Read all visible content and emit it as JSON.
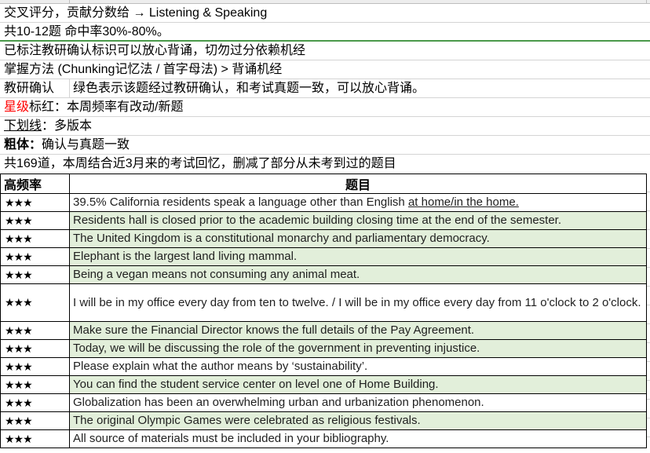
{
  "notes": [
    {
      "text": "交叉评分，贡献分数给 → Listening & Speaking"
    },
    {
      "text": "共10-12题  命中率30%-80%。"
    },
    {
      "text": "已标注教研确认标识可以放心背诵，切勿过分依赖机经"
    },
    {
      "text": "掌握方法 (Chunking记忆法 / 首字母法)  >  背诵机经"
    },
    {
      "label": "教研确认",
      "text": "绿色表示该题经过教研确认，和考试真题一致，可以放心背诵。"
    },
    {
      "red_part": "星级",
      "text": "标红：本周频率有改动/新题"
    },
    {
      "underlined_part": "下划线",
      "text": "：多版本"
    },
    {
      "bold_part": "粗体：",
      "text": "确认与真题一致"
    },
    {
      "text": "共169道，本周结合近3月来的考试回忆，删减了部分从未考到过的题目"
    }
  ],
  "colors": {
    "confirmed_green": "#e2efda",
    "red_mark": "#ff0000",
    "divider_green": "#4a9a4a"
  },
  "table": {
    "headers": {
      "frequency": "高频率",
      "question": "题目"
    },
    "rows": [
      {
        "stars": "★★★",
        "text": "39.5% California residents speak a language other than English ",
        "underlined": "at home/in the home.",
        "confirmed": false
      },
      {
        "stars": "★★★",
        "text": "Residents hall is closed prior to the academic building closing time at the end of the semester.",
        "confirmed": true
      },
      {
        "stars": "★★★",
        "text": "The United Kingdom is a constitutional monarchy and parliamentary democracy.",
        "confirmed": true
      },
      {
        "stars": "★★★",
        "text": "Elephant is the largest land living mammal.",
        "confirmed": true
      },
      {
        "stars": "★★★",
        "text": "Being a vegan means not consuming any animal meat.",
        "confirmed": true
      },
      {
        "stars": "★★★",
        "text": "I will be in my office every day from ten to twelve. / I will be in my office every day from 11 o'clock to 2 o'clock.",
        "confirmed": false
      },
      {
        "stars": "★★★",
        "text": "Make sure the Financial Director knows the full details of the Pay Agreement.",
        "confirmed": true
      },
      {
        "stars": "★★★",
        "text": "Today, we will be discussing the role of the government in preventing injustice.",
        "confirmed": true
      },
      {
        "stars": "★★★",
        "text": "Please explain what the author means by ‘sustainability’.",
        "confirmed": false
      },
      {
        "stars": "★★★",
        "text": "You can find the student service center on level one of Home Building.",
        "confirmed": true
      },
      {
        "stars": "★★★",
        "text": "Globalization has been an overwhelming urban and urbanization phenomenon.",
        "confirmed": false
      },
      {
        "stars": "★★★",
        "text": "The original Olympic Games were celebrated as religious festivals.",
        "confirmed": true
      },
      {
        "stars": "★★★",
        "text": "All source of materials must be included in your bibliography.",
        "confirmed": false
      }
    ]
  }
}
